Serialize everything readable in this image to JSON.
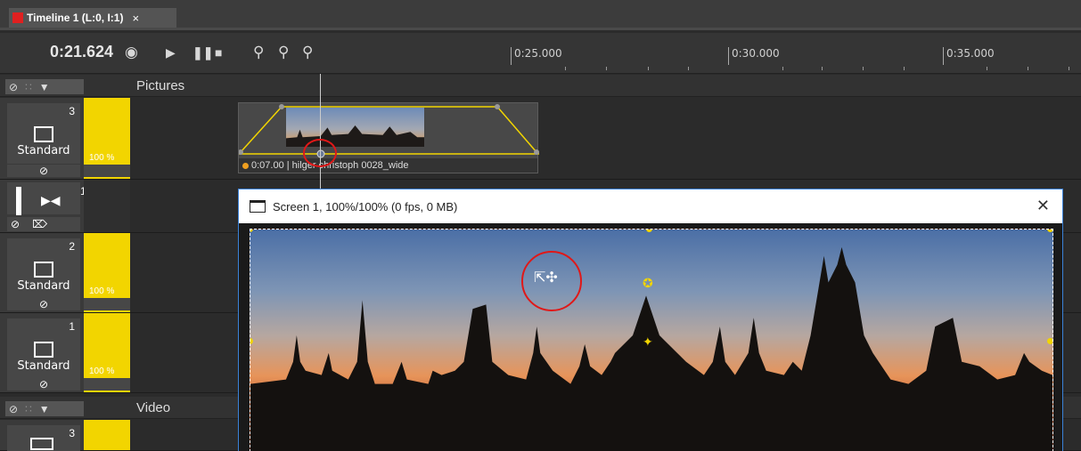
{
  "tab": {
    "title": "Timeline 1 (L:0, I:1)",
    "close": "×"
  },
  "toolbar": {
    "time": "0:21.624",
    "icons": [
      "eye-icon",
      "play-icon",
      "pause-icon",
      "stop-icon",
      "zoom-in-icon",
      "zoom-fit-icon",
      "zoom-out-icon"
    ]
  },
  "ruler": {
    "labels": [
      "0:25.000",
      "0:30.000",
      "0:35.000"
    ]
  },
  "groups": [
    {
      "name": "Pictures"
    },
    {
      "name": "Video"
    }
  ],
  "tracks": [
    {
      "num": "3",
      "label": "Standard",
      "pct": "100 %"
    },
    {
      "num": "1"
    },
    {
      "num": "2",
      "label": "Standard",
      "pct": "100 %"
    },
    {
      "num": "1",
      "label": "Standard",
      "pct": "100 %"
    },
    {
      "num": "3"
    }
  ],
  "clip": {
    "caption": "0:07.00 | hilger christoph 0028_wide"
  },
  "preview": {
    "title": "Screen 1, 100%/100% (0 fps, 0 MB)",
    "close": "✕"
  },
  "colors": {
    "accent": "#f2d500",
    "window_border": "#3a82d8",
    "annotation": "#e01818"
  }
}
